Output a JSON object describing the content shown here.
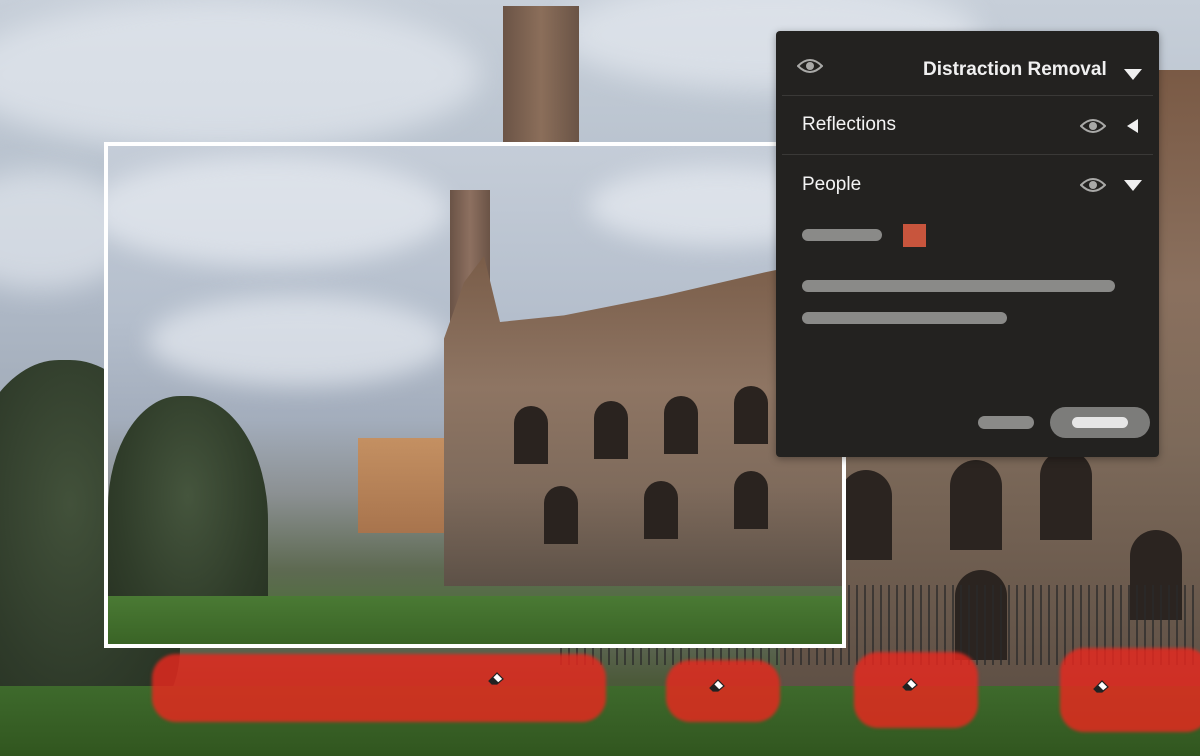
{
  "panel": {
    "title": "Distraction Removal",
    "sections": [
      {
        "label": "Reflections",
        "expanded": false
      },
      {
        "label": "People",
        "expanded": true
      }
    ],
    "people_highlight_color": "#c8553d"
  },
  "icons": {
    "visibility": "eye-icon",
    "expand": "triangle-down-icon",
    "collapsed": "triangle-left-icon",
    "brush": "eraser-icon"
  },
  "colors": {
    "panel_bg": "#232220",
    "highlight_red": "#e8281e"
  }
}
